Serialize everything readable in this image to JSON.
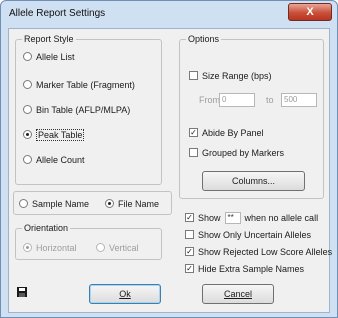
{
  "window": {
    "title": "Allele Report Settings",
    "close_glyph": "X"
  },
  "report_style": {
    "legend": "Report Style",
    "options": [
      {
        "label": "Allele List",
        "selected": false
      },
      {
        "label": "Marker Table (Fragment)",
        "selected": false
      },
      {
        "label": "Bin Table (AFLP/MLPA)",
        "selected": false
      },
      {
        "label": "Peak Table",
        "selected": true
      },
      {
        "label": "Allele Count",
        "selected": false
      }
    ]
  },
  "naming": {
    "sample_name": {
      "label": "Sample Name",
      "selected": false
    },
    "file_name": {
      "label": "File Name",
      "selected": true
    }
  },
  "orientation": {
    "legend": "Orientation",
    "horizontal": {
      "label": "Horizontal",
      "selected": true
    },
    "vertical": {
      "label": "Vertical",
      "selected": false
    }
  },
  "options": {
    "legend": "Options",
    "size_range": {
      "label": "Size Range (bps)",
      "checked": false
    },
    "from_label": "From",
    "from_value": "0",
    "to_label": "to",
    "to_value": "500",
    "abide_by_panel": {
      "label": "Abide By Panel",
      "checked": true
    },
    "grouped_by_markers": {
      "label": "Grouped by Markers",
      "checked": false
    },
    "columns_button": "Columns..."
  },
  "show_row": {
    "prefix": "Show",
    "value": "**",
    "suffix": "when no allele call",
    "checked": true
  },
  "show_only_uncertain": {
    "label": "Show Only Uncertain Alleles",
    "checked": false
  },
  "show_rejected": {
    "label": "Show Rejected Low Score Alleles",
    "checked": true
  },
  "hide_extra": {
    "label": "Hide Extra Sample Names",
    "checked": true
  },
  "buttons": {
    "ok": "Ok",
    "cancel": "Cancel"
  },
  "icons": {
    "save": "floppy-disk-icon",
    "close": "close-icon"
  },
  "colors": {
    "frame": "#cfe0f3",
    "client": "#f0f0f0",
    "close_button": "#c9503b"
  }
}
